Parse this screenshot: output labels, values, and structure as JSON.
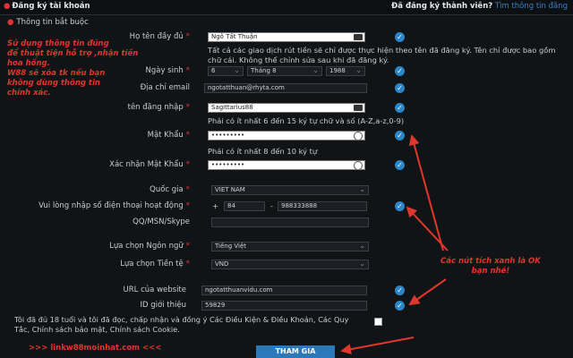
{
  "header": {
    "title": "Đăng ký tài khoản",
    "already_member": "Đã đăng ký thành viên?",
    "login_link": "Tìm thông tin đăng"
  },
  "section_title": "Thông tin bắt buộc",
  "fields": {
    "fullname": {
      "label": "Họ tên đầy đủ",
      "value": "Ngô Tất Thuận"
    },
    "fullname_note": "Tất cả các giao dịch rút tiền sẽ chỉ được thực hiện theo tên đã đăng ký. Tên chỉ được bao gồm chữ cái. Không thể chỉnh sửa sau khi đã đăng ký.",
    "dob": {
      "label": "Ngày sinh",
      "day": "6",
      "month": "Tháng 8",
      "year": "1988"
    },
    "email": {
      "label": "Địa chỉ email",
      "value": "ngotatthuan@rhyta.com"
    },
    "username": {
      "label": "tên đăng nhập",
      "value": "Sagittarius88"
    },
    "username_note": "Phải có ít nhất 6 đến 15 ký tự chữ và số (A-Z,a-z,0-9)",
    "password": {
      "label": "Mật Khẩu",
      "value": "•••••••••"
    },
    "password_note": "Phải có ít nhất 8 đến 10 ký tự",
    "confirm_password": {
      "label": "Xác nhận Mật Khẩu",
      "value": "•••••••••"
    },
    "country": {
      "label": "Quốc gia",
      "value": "VIET NAM"
    },
    "phone": {
      "label": "Vui lòng nhập số điện thoại hoạt động",
      "plus": "+",
      "code": "84",
      "dash": "-",
      "number": "988333888"
    },
    "qq": {
      "label": "QQ/MSN/Skype",
      "value": ""
    },
    "language": {
      "label": "Lựa chọn Ngôn ngữ",
      "value": "Tiếng Việt"
    },
    "currency": {
      "label": "Lựa chọn Tiền tệ",
      "value": "VND"
    },
    "website": {
      "label": "URL của website",
      "value": "ngotatthuanvidu.com"
    },
    "referral": {
      "label": "ID giới thiệu",
      "value": "59829"
    }
  },
  "terms": "Tôi đã đủ 18 tuổi và tôi đã đọc, chấp nhận và đồng ý Các Điều Kiện & Điều Khoản, Các Quy Tắc, Chính sách bảo mật, Chính sách Cookie.",
  "submit_label": "THAM GIA",
  "annotations": {
    "left_note": [
      "Sử dụng thông tin đúng",
      "để thuật tiện hỗ trợ ,nhận tiền",
      "hoa hồng.",
      "W88 sẽ xóa tk nếu bạn",
      "không dùng thông tin",
      "chính xác."
    ],
    "right_note": [
      "Các nút tích xanh là OK",
      "bạn nhé!"
    ],
    "link": ">>> linkw88moinhat.com <<<"
  },
  "colors": {
    "accent": "#2a86c9",
    "annotation": "#e0362c",
    "background": "#111417"
  }
}
